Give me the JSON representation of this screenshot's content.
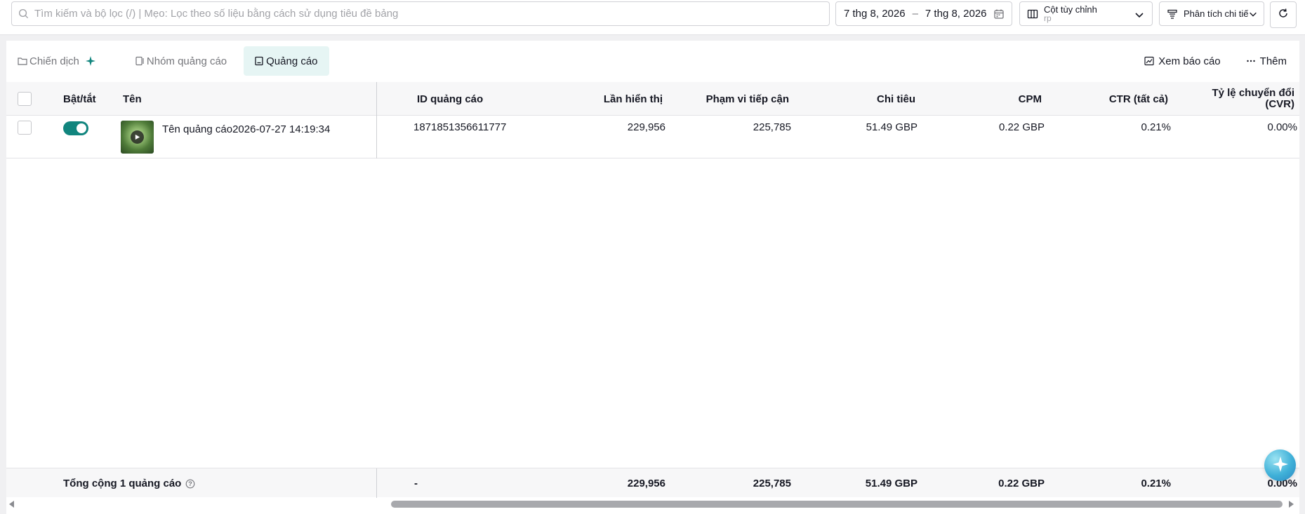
{
  "search": {
    "placeholder": "Tìm kiếm và bộ lọc (/) | Mẹo: Lọc theo số liệu bằng cách sử dụng tiêu đề bảng"
  },
  "date_range": {
    "start": "7 thg 8, 2026",
    "separator": "–",
    "end": "7 thg 8, 2026"
  },
  "columns_select": {
    "label": "Cột tùy chỉnh",
    "sub": "rp"
  },
  "analysis_button": {
    "label": "Phân tích chi tiết"
  },
  "tabs": [
    {
      "label": "Chiến dịch"
    },
    {
      "label": "Nhóm quảng cáo"
    },
    {
      "label": "Quảng cáo"
    }
  ],
  "tab_actions": {
    "report": "Xem báo cáo",
    "more": "Thêm"
  },
  "table": {
    "headers": {
      "toggle": "Bật/tắt",
      "name": "Tên",
      "ad_id": "ID quảng cáo",
      "impressions": "Lần hiển thị",
      "reach": "Phạm vi tiếp cận",
      "spend": "Chi tiêu",
      "cpm": "CPM",
      "ctr": "CTR (tất cả)",
      "cvr_1": "Tỷ lệ chuyển đổi",
      "cvr_2": "(CVR)"
    },
    "rows": [
      {
        "enabled": true,
        "name": "Tên quảng cáo2026-07-27 14:19:34",
        "ad_id": "1871851356611777",
        "impressions": "229,956",
        "reach": "225,785",
        "spend": "51.49 GBP",
        "cpm": "0.22 GBP",
        "ctr": "0.21%",
        "cvr": "0.00%"
      }
    ],
    "footer": {
      "label": "Tổng cộng 1 quảng cáo",
      "ad_id": "-",
      "impressions": "229,956",
      "reach": "225,785",
      "spend": "51.49 GBP",
      "cpm": "0.22 GBP",
      "ctr": "0.21%",
      "cvr": "0.00%"
    }
  },
  "colors": {
    "accent": "#11857e",
    "active_tab_bg": "#e6f5f4"
  }
}
